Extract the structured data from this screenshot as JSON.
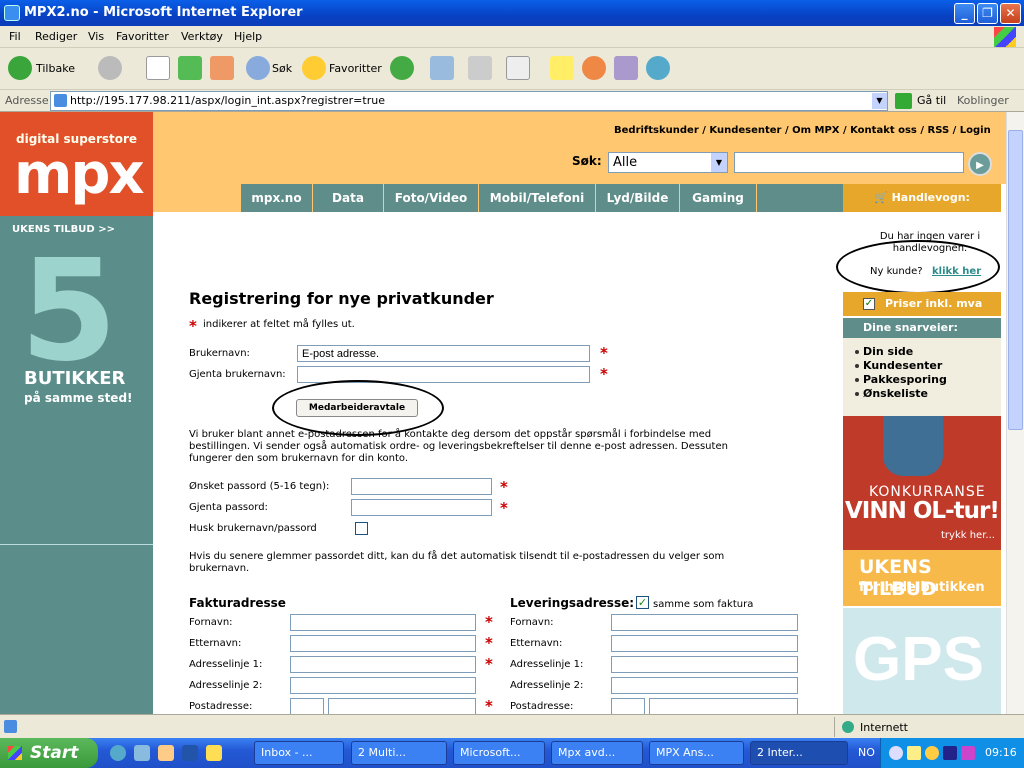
{
  "window": {
    "title": "MPX2.no - Microsoft Internet Explorer",
    "min": "_",
    "max": "❐",
    "close": "✕"
  },
  "menu": [
    "Fil",
    "Rediger",
    "Vis",
    "Favoritter",
    "Verktøy",
    "Hjelp"
  ],
  "toolbar": {
    "back": "Tilbake",
    "search": "Søk",
    "favorites": "Favoritter"
  },
  "address": {
    "label": "Adresse",
    "url": "http://195.177.98.211/aspx/login_int.aspx?registrer=true",
    "go": "Gå til",
    "links": "Koblinger"
  },
  "site": {
    "logo_sub": "digital superstore",
    "logo": "mpx",
    "toplinks": "Bedriftskunder  / Kundesenter  / Om MPX  / Kontakt oss  / RSS  / Login",
    "search_label": "Søk:",
    "search_select": "Alle",
    "nav": [
      "mpx.no",
      "Data",
      "Foto/Video",
      "Mobil/Telefoni",
      "Lyd/Bilde",
      "Gaming"
    ],
    "cart": "Handlevogn:",
    "left_ukens": "UKENS TILBUD >>",
    "left_five": "5",
    "left_butikker": "BUTIKKER",
    "left_sted": "på samme sted!",
    "cart_empty_1": "Du har ingen varer i",
    "cart_empty_2": "handlevognen.",
    "ny_kunde": "Ny kunde?",
    "klikk_her": "klikk her",
    "priser": "Priser inkl. mva",
    "snarveier": "Dine snarveier:",
    "snarveier_items": [
      "Din side",
      "Kundesenter",
      "Pakkesporing",
      "Ønskeliste"
    ],
    "ad1_k": "KONKURRANSE",
    "ad1_v": "VINN OL-tur!",
    "ad1_t": "trykk her...",
    "ad2_a": "UKENS TILBUD",
    "ad2_b": "for hele butikken",
    "ad3": "GPS"
  },
  "form": {
    "title": "Registrering for nye privatkunder",
    "required_note": "indikerer at feltet må fylles ut.",
    "star": "*",
    "brukernavn": "Brukernavn:",
    "brukernavn_value": "E-post adresse.",
    "gjenta_brukernavn": "Gjenta brukernavn:",
    "medarbeider": "Medarbeideravtale",
    "info1": "Vi bruker blant annet e-postadressen for å kontakte deg dersom det oppstår spørsmål i forbindelse med",
    "info2": "bestillingen. Vi sender også automatisk ordre- og leveringsbekreftelser til denne e-post adressen. Dessuten",
    "info3": "fungerer den som brukernavn for din konto.",
    "passord": "Ønsket passord (5-16 tegn):",
    "gjenta_passord": "Gjenta passord:",
    "husk": "Husk brukernavn/passord",
    "glemmer1": "Hvis du senere glemmer passordet ditt, kan du få det automatisk tilsendt til e-postadressen du velger som",
    "glemmer2": "brukernavn.",
    "faktura": "Fakturadresse",
    "levering": "Leveringsadresse:",
    "samme": "samme som faktura",
    "fields": [
      "Fornavn:",
      "Etternavn:",
      "Adresselinje 1:",
      "Adresselinje 2:",
      "Postadresse:"
    ]
  },
  "status": {
    "zone": "Internett"
  },
  "taskbar": {
    "start": "Start",
    "items": [
      "Inbox - ...",
      "2 Multi...",
      "Microsoft...",
      "Mpx avd...",
      "MPX Ans...",
      "2 Inter..."
    ],
    "lang": "NO",
    "clock": "09:16"
  }
}
